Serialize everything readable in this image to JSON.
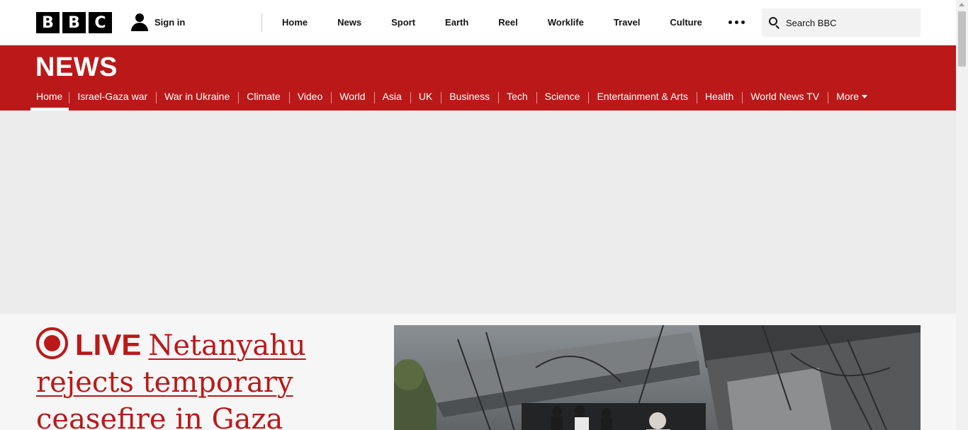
{
  "brand": {
    "letters": [
      "B",
      "B",
      "C"
    ]
  },
  "account": {
    "signin_label": "Sign in"
  },
  "top_nav": {
    "items": [
      "Home",
      "News",
      "Sport",
      "Earth",
      "Reel",
      "Worklife",
      "Travel",
      "Culture"
    ]
  },
  "search": {
    "placeholder": "Search BBC"
  },
  "section": {
    "title": "NEWS"
  },
  "sub_nav": {
    "items": [
      "Home",
      "Israel-Gaza war",
      "War in Ukraine",
      "Climate",
      "Video",
      "World",
      "Asia",
      "UK",
      "Business",
      "Tech",
      "Science",
      "Entertainment & Arts",
      "Health",
      "World News TV"
    ],
    "more_label": "More",
    "active_index": 0
  },
  "lead_story": {
    "live_label": "LIVE",
    "headline": "Netanyahu rejects temporary ceasefire in Gaza"
  },
  "colors": {
    "brand_red": "#bb1919",
    "ad_background": "#ececec",
    "search_background": "#f2f2f2"
  }
}
